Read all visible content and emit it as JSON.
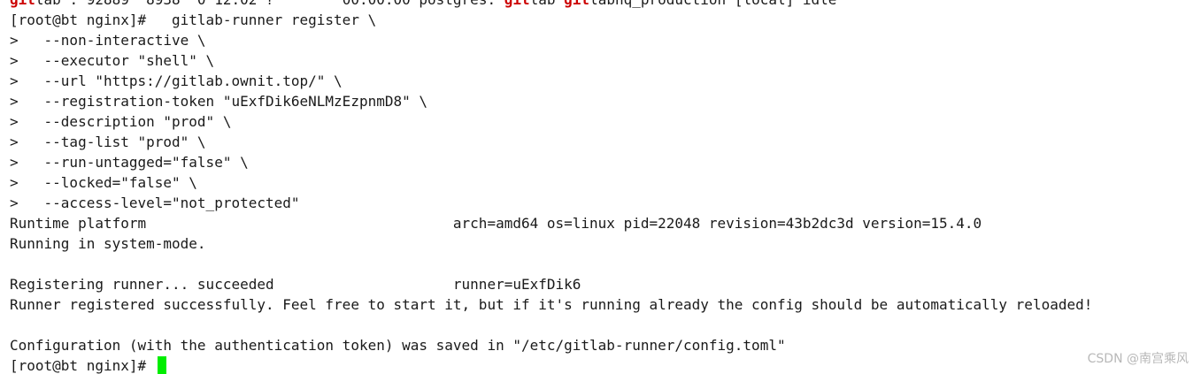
{
  "terminal": {
    "partial_top_line": {
      "prefix": "git",
      "rest_a": "lab : 92889  8938  0 12:02 ?        00:00:00 postgres: ",
      "red_1": "git",
      "rest_b": "lab ",
      "red_2": "git",
      "rest_c": "labhq_production [local] idle"
    },
    "lines": [
      "[root@bt nginx]#   gitlab-runner register \\",
      ">   --non-interactive \\",
      ">   --executor \"shell\" \\",
      ">   --url \"https://gitlab.ownit.top/\" \\",
      ">   --registration-token \"uExfDik6eNLMzEzpnmD8\" \\",
      ">   --description \"prod\" \\",
      ">   --tag-list \"prod\" \\",
      ">   --run-untagged=\"false\" \\",
      ">   --locked=\"false\" \\",
      ">   --access-level=\"not_protected\"",
      "Runtime platform                                    arch=amd64 os=linux pid=22048 revision=43b2dc3d version=15.4.0",
      "Running in system-mode.",
      "",
      "Registering runner... succeeded                     runner=uExfDik6",
      "Runner registered successfully. Feel free to start it, but if it's running already the config should be automatically reloaded!",
      "",
      "Configuration (with the authentication token) was saved in \"/etc/gitlab-runner/config.toml\""
    ],
    "prompt": "[root@bt nginx]# ",
    "cursor_color": "#00ee00"
  },
  "watermark": "CSDN @南宫乘风"
}
